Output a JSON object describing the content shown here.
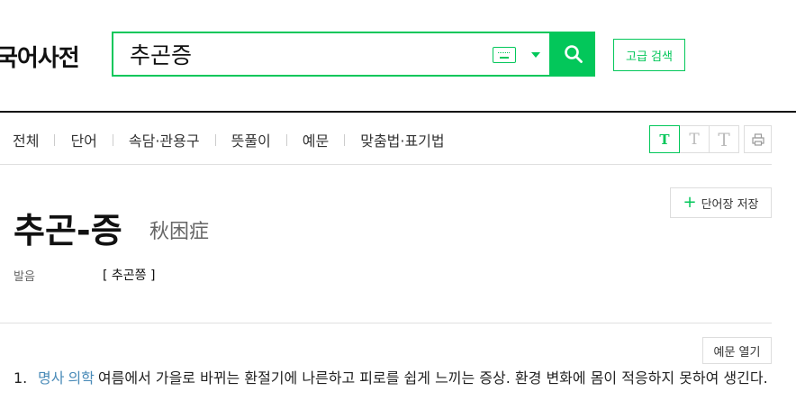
{
  "header": {
    "logo": "국어사전",
    "search": {
      "value": "추곤증",
      "placeholder": ""
    },
    "advanced_search_label": "고급 검색"
  },
  "tabs": [
    "전체",
    "단어",
    "속담·관용구",
    "뜻풀이",
    "예문",
    "맞춤법·표기법"
  ],
  "font_size_buttons": [
    "T",
    "T",
    "T"
  ],
  "entry": {
    "headword": "추곤-증",
    "hanja": "秋困症",
    "save_label": "단어장 저장",
    "pronunciation_label": "발음",
    "pronunciation_value": "[ 추곤쯩 ]",
    "examples_toggle_label": "예문 열기",
    "definitions": [
      {
        "number": "1.",
        "part_of_speech": "명사",
        "field": "의학",
        "text": "여름에서 가을로 바뀌는 환절기에 나른하고 피로를 쉽게 느끼는 증상. 환경 변화에 몸이 적응하지 못하여 생긴다."
      }
    ]
  },
  "colors": {
    "accent": "#03c75a",
    "pos_link": "#4a8bb8"
  }
}
